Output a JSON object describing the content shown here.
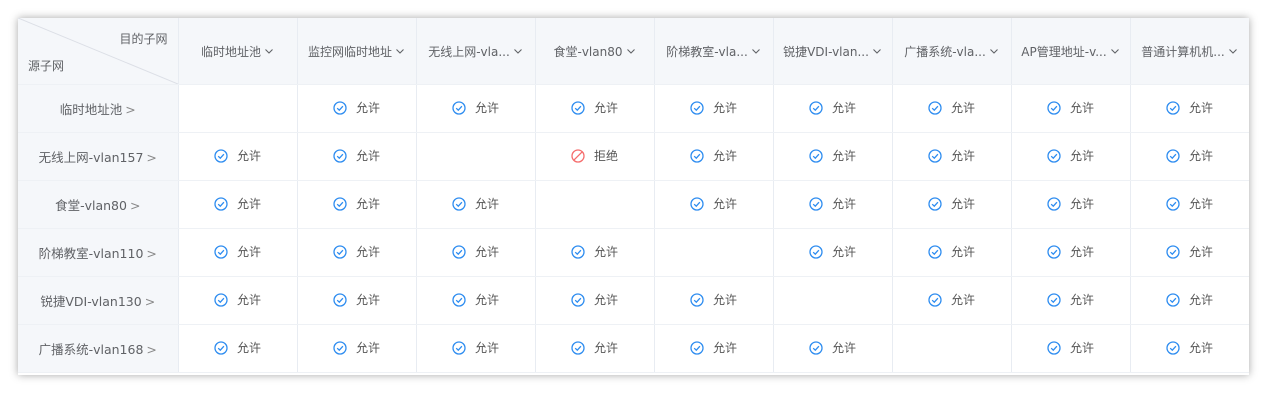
{
  "corner": {
    "dest_label": "目的子网",
    "src_label": "源子网"
  },
  "columns": [
    "临时地址池",
    "监控网临时地址",
    "无线上网-vla...",
    "食堂-vlan80",
    "阶梯教室-vla...",
    "锐捷VDI-vlan...",
    "广播系统-vla...",
    "AP管理地址-v...",
    "普通计算机机..."
  ],
  "rows": [
    {
      "label": "临时地址池",
      "cells": [
        "",
        "allow",
        "allow",
        "allow",
        "allow",
        "allow",
        "allow",
        "allow",
        "allow"
      ]
    },
    {
      "label": "无线上网-vlan157",
      "cells": [
        "allow",
        "allow",
        "",
        "deny",
        "allow",
        "allow",
        "allow",
        "allow",
        "allow"
      ]
    },
    {
      "label": "食堂-vlan80",
      "cells": [
        "allow",
        "allow",
        "allow",
        "",
        "allow",
        "allow",
        "allow",
        "allow",
        "allow"
      ]
    },
    {
      "label": "阶梯教室-vlan110",
      "cells": [
        "allow",
        "allow",
        "allow",
        "allow",
        "",
        "allow",
        "allow",
        "allow",
        "allow"
      ]
    },
    {
      "label": "锐捷VDI-vlan130",
      "cells": [
        "allow",
        "allow",
        "allow",
        "allow",
        "allow",
        "",
        "allow",
        "allow",
        "allow"
      ]
    },
    {
      "label": "广播系统-vlan168",
      "cells": [
        "allow",
        "allow",
        "allow",
        "allow",
        "allow",
        "allow",
        "",
        "allow",
        "allow"
      ]
    }
  ],
  "labels": {
    "allow": "允许",
    "deny": "拒绝",
    "row_chevron": ">"
  },
  "colors": {
    "allow_icon": "#2d8cf0",
    "deny_icon": "#f56c6c",
    "header_bg": "#f5f7fa"
  },
  "icons": {
    "allow": "check-circle-icon",
    "deny": "forbidden-icon",
    "column_dropdown": "chevron-down-icon"
  }
}
